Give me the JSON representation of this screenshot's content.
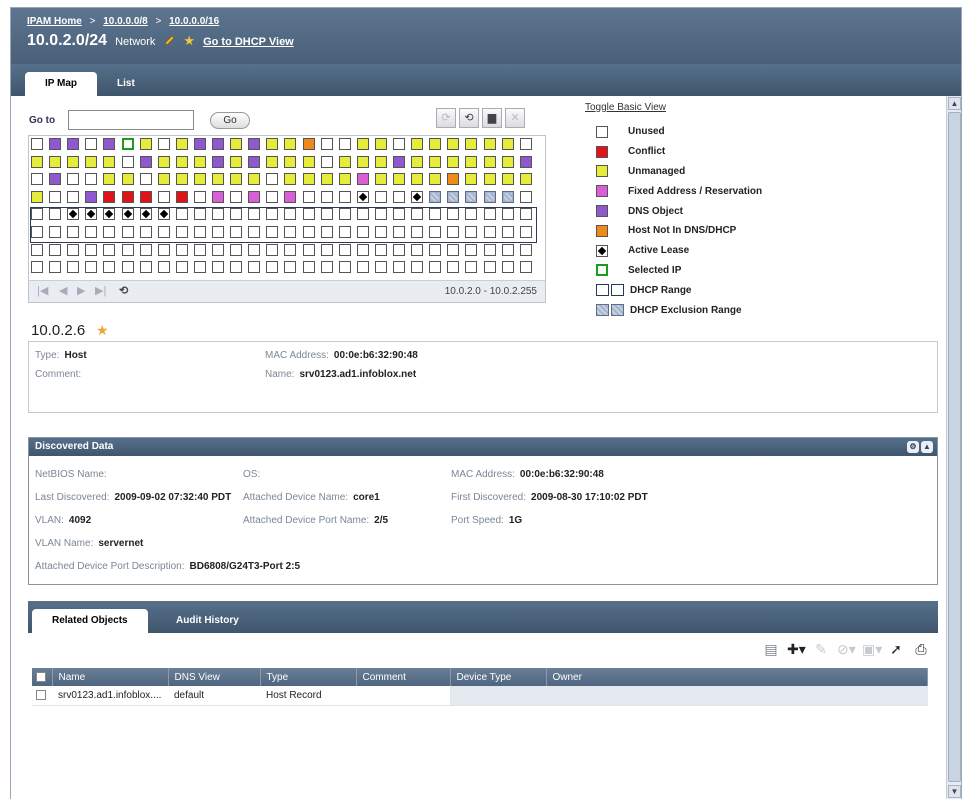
{
  "breadcrumb": {
    "home": "IPAM Home",
    "sep": ">",
    "crumb1": "10.0.0.0/8",
    "crumb2": "10.0.0.0/16"
  },
  "title": {
    "network": "10.0.2.0/24",
    "type": "Network",
    "dhcp_link": "Go to DHCP View"
  },
  "tabs": {
    "ipmap": "IP Map",
    "list": "List"
  },
  "goto": {
    "label": "Go to",
    "value": "",
    "button": "Go"
  },
  "grid": {
    "range": "10.0.2.0 - 10.0.2.255",
    "rows": [
      [
        "U",
        "D",
        "D",
        "U",
        "D",
        "S",
        "Y",
        "U",
        "Y",
        "D",
        "D",
        "Y",
        "D",
        "Y",
        "Y",
        "H",
        "U",
        "U",
        "Y",
        "Y",
        "U",
        "Y",
        "Y",
        "Y",
        "Y",
        "Y",
        "Y",
        "U"
      ],
      [
        "Y",
        "Y",
        "Y",
        "Y",
        "Y",
        "U",
        "D",
        "Y",
        "Y",
        "Y",
        "D",
        "Y",
        "D",
        "Y",
        "Y",
        "Y",
        "U",
        "Y",
        "Y",
        "Y",
        "D",
        "Y",
        "Y",
        "Y",
        "Y",
        "Y",
        "Y",
        "D"
      ],
      [
        "U",
        "D",
        "U",
        "U",
        "Y",
        "Y",
        "U",
        "Y",
        "Y",
        "Y",
        "Y",
        "Y",
        "Y",
        "U",
        "Y",
        "Y",
        "Y",
        "Y",
        "F",
        "Y",
        "Y",
        "Y",
        "Y",
        "H",
        "Y",
        "Y",
        "Y",
        "Y"
      ],
      [
        "Y",
        "U",
        "U",
        "D",
        "C",
        "C",
        "C",
        "U",
        "C",
        "U",
        "F",
        "U",
        "F",
        "U",
        "F",
        "U",
        "U",
        "U",
        "L",
        "U",
        "U",
        "L",
        "E",
        "E",
        "E",
        "E",
        "E",
        "U"
      ],
      [
        "U",
        "U",
        "L",
        "L",
        "L",
        "L",
        "L",
        "L",
        "U",
        "U",
        "U",
        "U",
        "U",
        "U",
        "U",
        "U",
        "U",
        "U",
        "U",
        "U",
        "U",
        "U",
        "U",
        "U",
        "U",
        "U",
        "U",
        "U"
      ],
      [
        "U",
        "U",
        "U",
        "U",
        "U",
        "U",
        "U",
        "U",
        "U",
        "U",
        "U",
        "U",
        "U",
        "U",
        "U",
        "U",
        "U",
        "U",
        "U",
        "U",
        "U",
        "U",
        "U",
        "U",
        "U",
        "U",
        "U",
        "U"
      ],
      [
        "U",
        "U",
        "U",
        "U",
        "U",
        "U",
        "U",
        "U",
        "U",
        "U",
        "U",
        "U",
        "U",
        "U",
        "U",
        "U",
        "U",
        "U",
        "U",
        "U",
        "U",
        "U",
        "U",
        "U",
        "U",
        "U",
        "U",
        "U"
      ],
      [
        "U",
        "U",
        "U",
        "U",
        "U",
        "U",
        "U",
        "U",
        "U",
        "U",
        "U",
        "U",
        "U",
        "U",
        "U",
        "U",
        "U",
        "U",
        "U",
        "U",
        "U",
        "U",
        "U",
        "U",
        "U",
        "U",
        "U",
        "U"
      ]
    ]
  },
  "legend": {
    "toggle": "Toggle Basic View",
    "items": {
      "unused": "Unused",
      "conflict": "Conflict",
      "unmanaged": "Unmanaged",
      "fixed": "Fixed Address / Reservation",
      "dns": "DNS Object",
      "host": "Host Not In DNS/DHCP",
      "lease": "Active Lease",
      "selected": "Selected IP",
      "range": "DHCP Range",
      "exclusion": "DHCP Exclusion Range"
    }
  },
  "selected_ip": {
    "address": "10.0.2.6",
    "type_label": "Type:",
    "type_value": "Host",
    "comment_label": "Comment:",
    "mac_label": "MAC Address:",
    "mac_value": "00:0e:b6:32:90:48",
    "name_label": "Name:",
    "name_value": "srv0123.ad1.infoblox.net"
  },
  "discovered": {
    "title": "Discovered Data",
    "netbios_label": "NetBIOS Name:",
    "os_label": "OS:",
    "mac_label": "MAC Address:",
    "mac_value": "00:0e:b6:32:90:48",
    "last_label": "Last Discovered:",
    "last_value": "2009-09-02 07:32:40 PDT",
    "attached_name_label": "Attached Device Name:",
    "attached_name_value": "core1",
    "first_label": "First Discovered:",
    "first_value": "2009-08-30 17:10:02 PDT",
    "vlan_label": "VLAN:",
    "vlan_value": "4092",
    "port_name_label": "Attached Device Port Name:",
    "port_name_value": "2/5",
    "speed_label": "Port Speed:",
    "speed_value": "1G",
    "vlan_name_label": "VLAN Name:",
    "vlan_name_value": "servernet",
    "port_desc_label": "Attached Device Port Description:",
    "port_desc_value": "BD6808/G24T3-Port 2:5"
  },
  "related": {
    "tab_related": "Related Objects",
    "tab_audit": "Audit History",
    "columns": [
      "Name",
      "DNS View",
      "Type",
      "Comment",
      "Device Type",
      "Owner"
    ],
    "rows": [
      {
        "name": "srv0123.ad1.infoblox....",
        "dns_view": "default",
        "type": "Host Record",
        "comment": "",
        "device_type": "",
        "owner": ""
      }
    ]
  },
  "colors": {
    "unused": "#ffffff",
    "conflict": "#e01418",
    "unmanaged": "#e5ec3a",
    "fixed": "#d95fd6",
    "dns": "#8f58cf",
    "host": "#ef8a1a",
    "selected": "#1e9a1e",
    "header": "#4a6078"
  }
}
